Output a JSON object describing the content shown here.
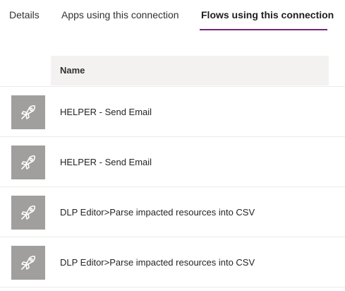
{
  "tabs": [
    {
      "label": "Details",
      "active": false
    },
    {
      "label": "Apps using this connection",
      "active": false
    },
    {
      "label": "Flows using this connection",
      "active": true
    }
  ],
  "table": {
    "column_name": "Name",
    "rows": [
      {
        "name": "HELPER - Send Email",
        "icon": "rocket-icon"
      },
      {
        "name": "HELPER - Send Email",
        "icon": "rocket-icon"
      },
      {
        "name": "DLP Editor>Parse impacted resources into CSV",
        "icon": "rocket-icon"
      },
      {
        "name": "DLP Editor>Parse impacted resources into CSV",
        "icon": "rocket-icon"
      }
    ]
  },
  "colors": {
    "accent": "#742774",
    "icon_tile": "#a19f9d",
    "header_bg": "#f3f2f1"
  }
}
